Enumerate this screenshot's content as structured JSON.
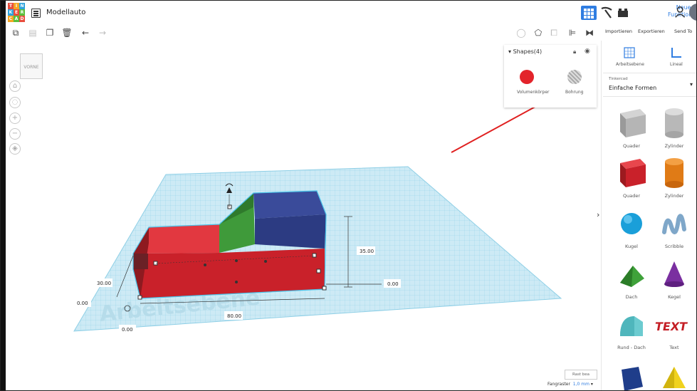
{
  "app": {
    "title": "Modellauto",
    "new_features": [
      "Neue",
      "Funktionen"
    ]
  },
  "logo": [
    "TIN",
    "KER",
    "CAD"
  ],
  "toolbar_right": {
    "import": "Importieren",
    "export": "Exportieren",
    "send_to": "Send To"
  },
  "viewcube": {
    "face": "VORNE"
  },
  "shapes_panel": {
    "header": "Shapes(4)",
    "solid_label": "Volumenkörper",
    "hole_label": "Bohrung",
    "solid_color": "#e3242b"
  },
  "right_panel": {
    "workplane": "Arbeitsebene",
    "ruler": "Lineal",
    "category_hint": "Tinkercad",
    "category": "Einfache Formen",
    "shapes": [
      {
        "label": "Quader"
      },
      {
        "label": "Zylinder"
      },
      {
        "label": "Quader"
      },
      {
        "label": "Zylinder"
      },
      {
        "label": "Kugel"
      },
      {
        "label": "Scribble"
      },
      {
        "label": "Dach"
      },
      {
        "label": "Kegel"
      },
      {
        "label": "Rund - Dach"
      },
      {
        "label": "Text"
      }
    ]
  },
  "workplane_label": "Arbeitsebene",
  "dimensions": {
    "height": "35.00",
    "depth": "30.00",
    "length": "80.00",
    "offset_right": "0.00",
    "origin_x": "0.00",
    "origin_y": "0.00"
  },
  "footer": {
    "edit_grid": "Rast bea",
    "snap_label": "Fangraster",
    "snap_value": "1,0 mm"
  },
  "colors": {
    "accent": "#2f7de1",
    "grid": "#a9dcef",
    "body_red": "#d0232c",
    "roof_blue": "#3a4b9a",
    "window_green": "#3f9a3a",
    "arrow": "#e02020"
  }
}
